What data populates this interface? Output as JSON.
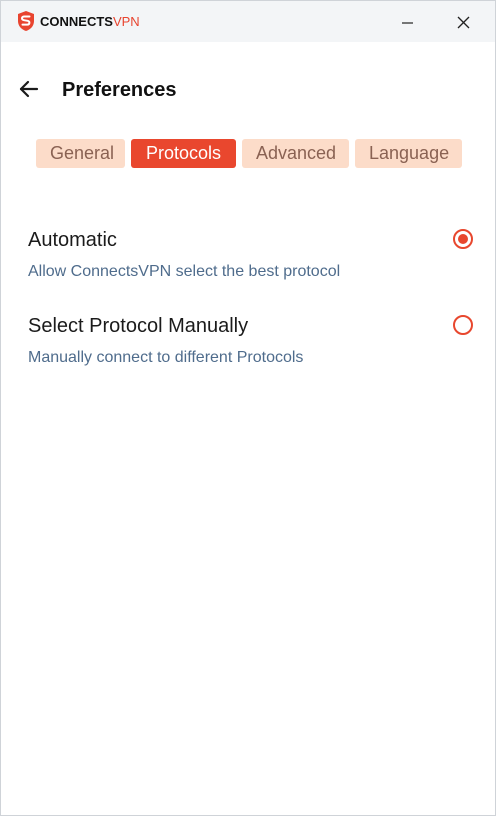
{
  "app": {
    "brand_bold": "CONNECTS",
    "brand_accent": "VPN",
    "accent_color": "#e9472e"
  },
  "window_controls": {
    "minimize_icon": "minimize-icon",
    "close_icon": "close-icon"
  },
  "header": {
    "back_icon": "arrow-left-icon",
    "title": "Preferences"
  },
  "tabs": [
    {
      "label": "General",
      "selected": false
    },
    {
      "label": "Protocols",
      "selected": true
    },
    {
      "label": "Advanced",
      "selected": false
    },
    {
      "label": "Language",
      "selected": false
    }
  ],
  "protocol_options": [
    {
      "title": "Automatic",
      "description": "Allow ConnectsVPN select the best protocol",
      "selected": true
    },
    {
      "title": "Select Protocol Manually",
      "description": "Manually connect to different Protocols",
      "selected": false
    }
  ]
}
